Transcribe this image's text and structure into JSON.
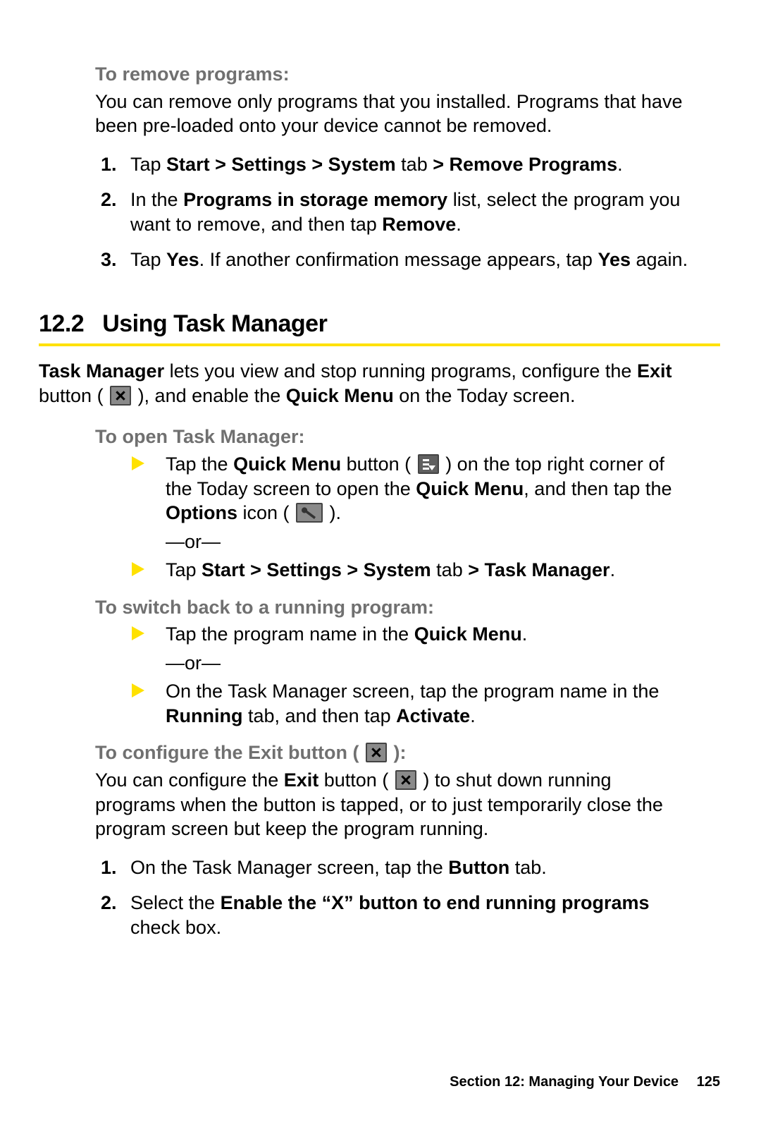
{
  "section1": {
    "subhead": "To remove programs:",
    "para": "You can remove only programs that you installed. Programs that have been pre-loaded onto your device cannot be removed.",
    "steps": [
      {
        "pre": "Tap ",
        "bold1": "Start > Settings > System",
        "mid1": " tab ",
        "bold2": "> Remove Programs",
        "post": "."
      },
      {
        "pre": "In the ",
        "bold1": "Programs in storage memory",
        "mid1": " list, select the program you want to remove, and then tap ",
        "bold2": "Remove",
        "post": "."
      },
      {
        "pre": "Tap ",
        "bold1": "Yes",
        "mid1": ". If another confirmation message appears, tap ",
        "bold2": "Yes",
        "post": " again."
      }
    ]
  },
  "heading": {
    "num": "12.2",
    "title": "Using Task Manager"
  },
  "intro": {
    "pre": "",
    "tm": "Task Manager",
    "t1": " lets you view and stop running programs, configure the ",
    "exit": "Exit",
    "t2": " button ( ",
    "t3": " ), and enable the ",
    "qm": "Quick Menu",
    "t4": " on the Today screen."
  },
  "open": {
    "subhead": "To open Task Manager:",
    "b1": {
      "pre": "Tap the ",
      "qmb": "Quick Menu",
      "t1": " button ( ",
      "t2": " ) on the top right corner of the Today screen to open the ",
      "qm2": "Quick Menu",
      "t3": ", and then tap the ",
      "opt": "Options",
      "t4": " icon ( ",
      "t5": " )."
    },
    "or": "—or—",
    "b2": {
      "pre": "Tap ",
      "bold1": "Start > Settings > System",
      "mid": " tab ",
      "bold2": "> Task Manager",
      "post": "."
    }
  },
  "switch": {
    "subhead": "To switch back to a running program:",
    "b1": {
      "pre": "Tap the program name in the ",
      "qm": "Quick Menu",
      "post": "."
    },
    "or": "—or—",
    "b2": {
      "pre": "On the Task Manager screen, tap the program name in the ",
      "run": "Running",
      "mid": " tab, and then tap ",
      "act": "Activate",
      "post": "."
    }
  },
  "config": {
    "subhead_pre": "To configure the Exit button ( ",
    "subhead_post": " ):",
    "para": {
      "pre": "You can configure the ",
      "exit": "Exit",
      "t1": " button ( ",
      "t2": " ) to shut down running programs when the button is tapped, or to just temporarily close the program screen but keep the program running."
    },
    "steps": [
      {
        "pre": "On the Task Manager screen, tap the ",
        "bold1": "Button",
        "post": " tab."
      },
      {
        "pre": "Select the ",
        "bold1": "Enable the “X” button to end running programs",
        "post": " check box."
      }
    ]
  },
  "footer": {
    "text": "Section 12: Managing Your Device",
    "page": "125"
  }
}
